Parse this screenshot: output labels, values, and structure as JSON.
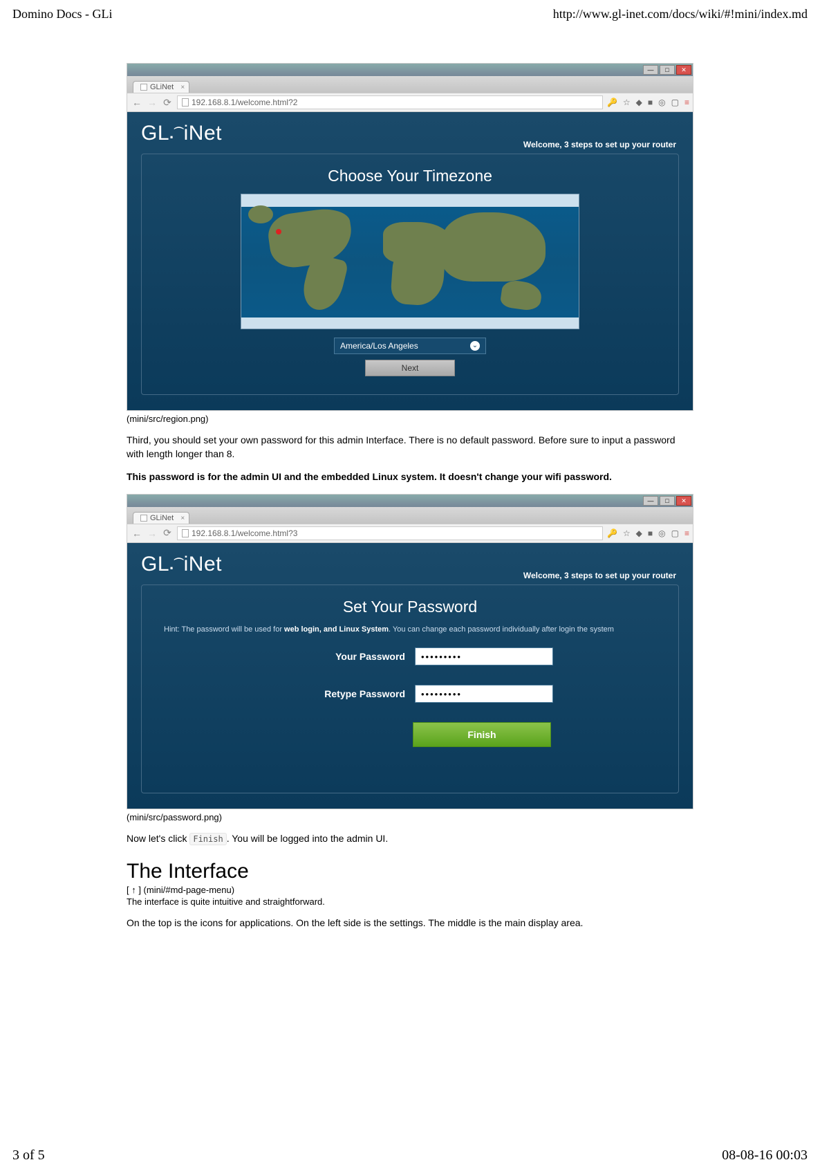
{
  "page": {
    "title_left": "Domino Docs - GLi",
    "title_right": "http://www.gl-inet.com/docs/wiki/#!mini/index.md",
    "footer_left": "3 of 5",
    "footer_right": "08-08-16 00:03"
  },
  "screenshot1": {
    "tab_label": "GLiNet",
    "url": "192.168.8.1/welcome.html?2",
    "logo": "GL.iNet",
    "welcome": "Welcome, 3 steps to set up your router",
    "panel_title": "Choose Your Timezone",
    "timezone": "America/Los Angeles",
    "next_label": "Next",
    "caption": "(mini/src/region.png)"
  },
  "body_text": {
    "p1": "Third, you should set your own password for this admin Interface. There is no default password. Before sure to input a password with length longer than 8.",
    "p2": "This password is for the admin UI and the embedded Linux system. It doesn't change your wifi password."
  },
  "screenshot2": {
    "tab_label": "GLiNet",
    "url": "192.168.8.1/welcome.html?3",
    "logo": "GL.iNet",
    "welcome": "Welcome, 3 steps to set up your router",
    "panel_title": "Set Your Password",
    "hint_pre": "Hint: The password will be used for ",
    "hint_bold": "web login, and Linux System",
    "hint_post": ". You can change each password individually after login the system",
    "label1": "Your Password",
    "label2": "Retype Password",
    "value_mask": "•••••••••",
    "finish_label": "Finish",
    "caption": "(mini/src/password.png)"
  },
  "after": {
    "p3a": "Now let's click ",
    "p3_code": "Finish",
    "p3b": ". You will be logged into the admin UI.",
    "heading": "The Interface",
    "anchor": "[ ↑ ] (mini/#md-page-menu)",
    "p4": "The interface is quite intuitive and straightforward.",
    "p5": "On the top is the icons for applications. On the left side is the settings. The middle is the main display area."
  }
}
